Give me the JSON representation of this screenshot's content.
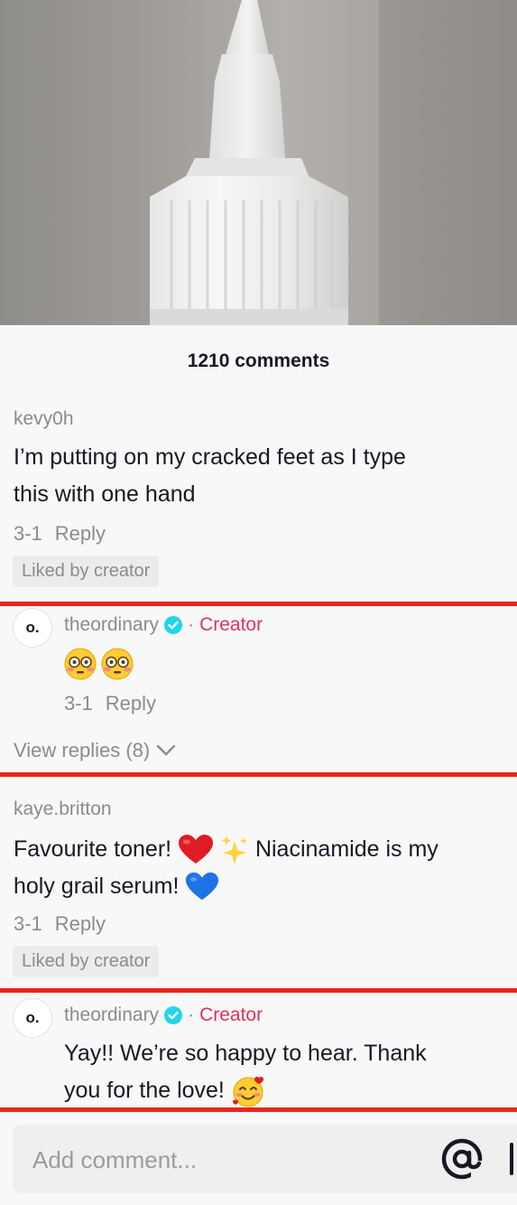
{
  "header": {
    "comment_count": "1210 comments"
  },
  "comments": [
    {
      "username": "kevy0h",
      "text_lines": [
        "I’m putting on my cracked feet as I type",
        "this with one hand"
      ],
      "date": "3-1",
      "reply_label": "Reply",
      "liked_badge": "Liked by creator"
    },
    {
      "avatar_text": "o.",
      "username": "theordinary",
      "separator": "·",
      "creator_label": "Creator",
      "emojis": [
        "flushed-face-emoji",
        "flushed-face-emoji"
      ],
      "date": "3-1",
      "reply_label": "Reply",
      "view_replies": "View replies (8)"
    },
    {
      "username": "kaye.britton",
      "line1_part1": "Favourite toner!",
      "line1_part2": "Niacinamide is my",
      "line2": "holy grail serum!",
      "date": "3-1",
      "reply_label": "Reply",
      "liked_badge": "Liked by creator"
    },
    {
      "avatar_text": "o.",
      "username": "theordinary",
      "separator": "·",
      "creator_label": "Creator",
      "line1": "Yay!! We’re so happy to hear. Thank",
      "line2": "you for the love!"
    }
  ],
  "composer": {
    "placeholder": "Add comment..."
  },
  "icons": {
    "verified": "verified-badge-icon",
    "chevron": "chevron-down-icon",
    "mention": "at-mention-icon"
  },
  "colors": {
    "highlight_line": "#e8261f",
    "creator": "#e0325c",
    "muted": "#8a8b91"
  }
}
